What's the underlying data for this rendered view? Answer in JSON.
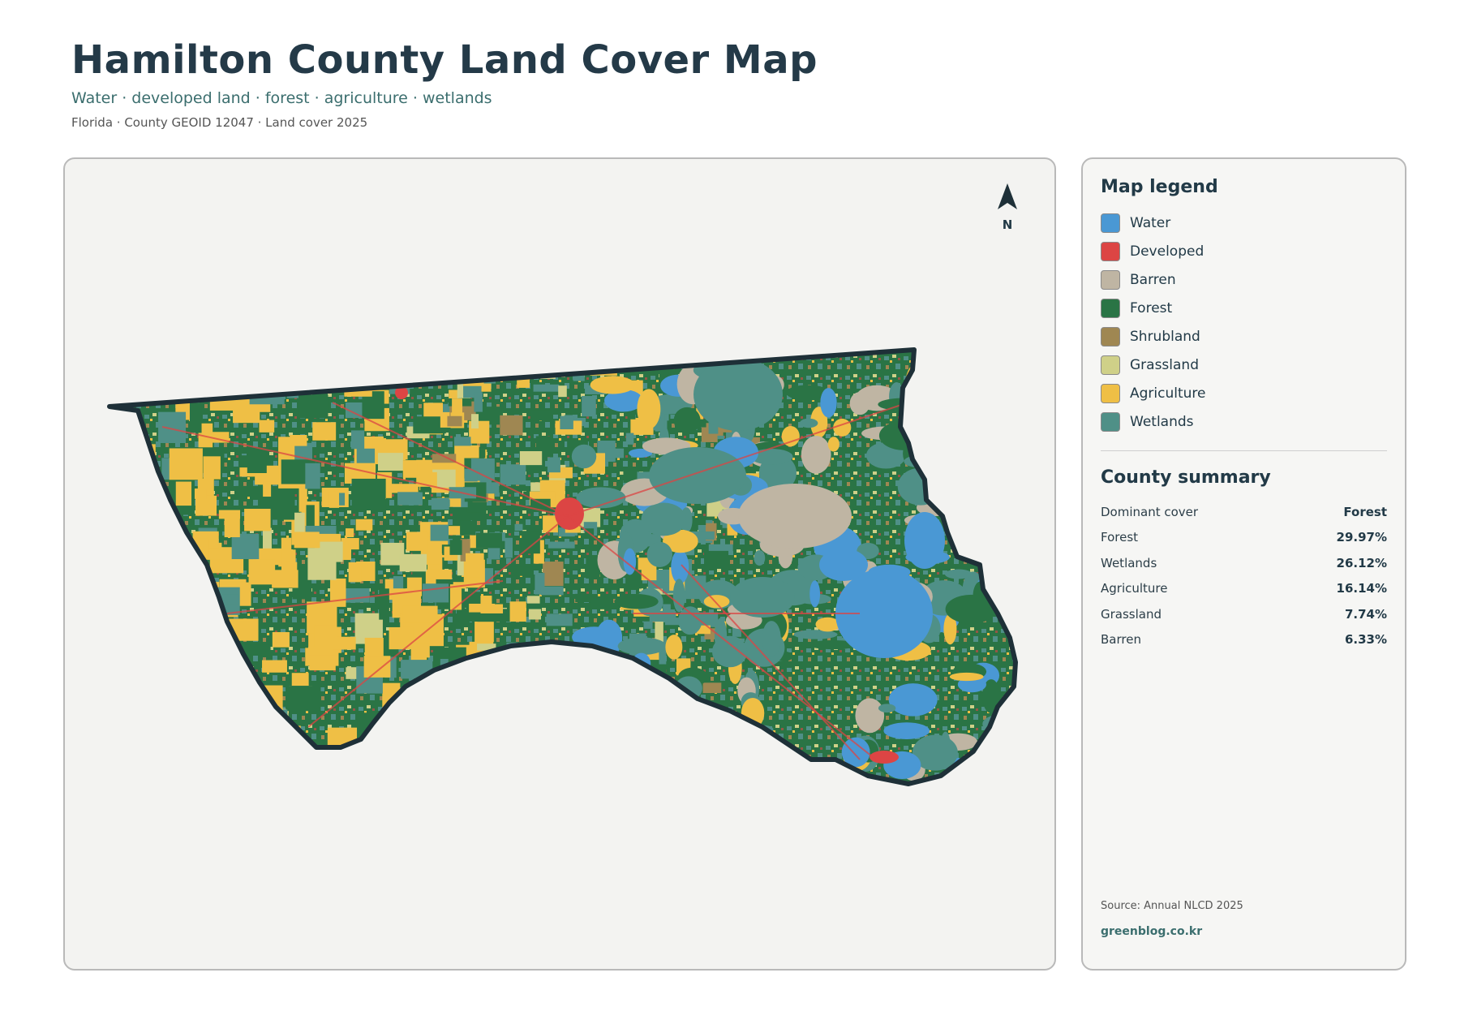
{
  "header": {
    "title": "Hamilton County Land Cover Map",
    "subtitle": "Water · developed land · forest · agriculture · wetlands",
    "meta": "Florida · County GEOID 12047 · Land cover 2025"
  },
  "map": {
    "north_label": "N",
    "colors": {
      "water": "#4a98d4",
      "developed": "#dc4544",
      "barren": "#bfb5a3",
      "forest": "#2a7445",
      "shrubland": "#9f8752",
      "grassland": "#cfd088",
      "agriculture": "#efbf45",
      "wetlands": "#4f9087",
      "outline": "#1e3038",
      "background": "#f3f3f1"
    }
  },
  "legend": {
    "title": "Map legend",
    "items": [
      {
        "label": "Water",
        "color": "#4a98d4"
      },
      {
        "label": "Developed",
        "color": "#dc4544"
      },
      {
        "label": "Barren",
        "color": "#bfb5a3"
      },
      {
        "label": "Forest",
        "color": "#2a7445"
      },
      {
        "label": "Shrubland",
        "color": "#9f8752"
      },
      {
        "label": "Grassland",
        "color": "#cfd088"
      },
      {
        "label": "Agriculture",
        "color": "#efbf45"
      },
      {
        "label": "Wetlands",
        "color": "#4f9087"
      }
    ]
  },
  "summary": {
    "title": "County summary",
    "rows": [
      {
        "label": "Dominant cover",
        "value": "Forest"
      },
      {
        "label": "Forest",
        "value": "29.97%"
      },
      {
        "label": "Wetlands",
        "value": "26.12%"
      },
      {
        "label": "Agriculture",
        "value": "16.14%"
      },
      {
        "label": "Grassland",
        "value": "7.74%"
      },
      {
        "label": "Barren",
        "value": "6.33%"
      }
    ]
  },
  "footer": {
    "source": "Source: Annual NLCD 2025",
    "brand": "greenblog.co.kr"
  }
}
